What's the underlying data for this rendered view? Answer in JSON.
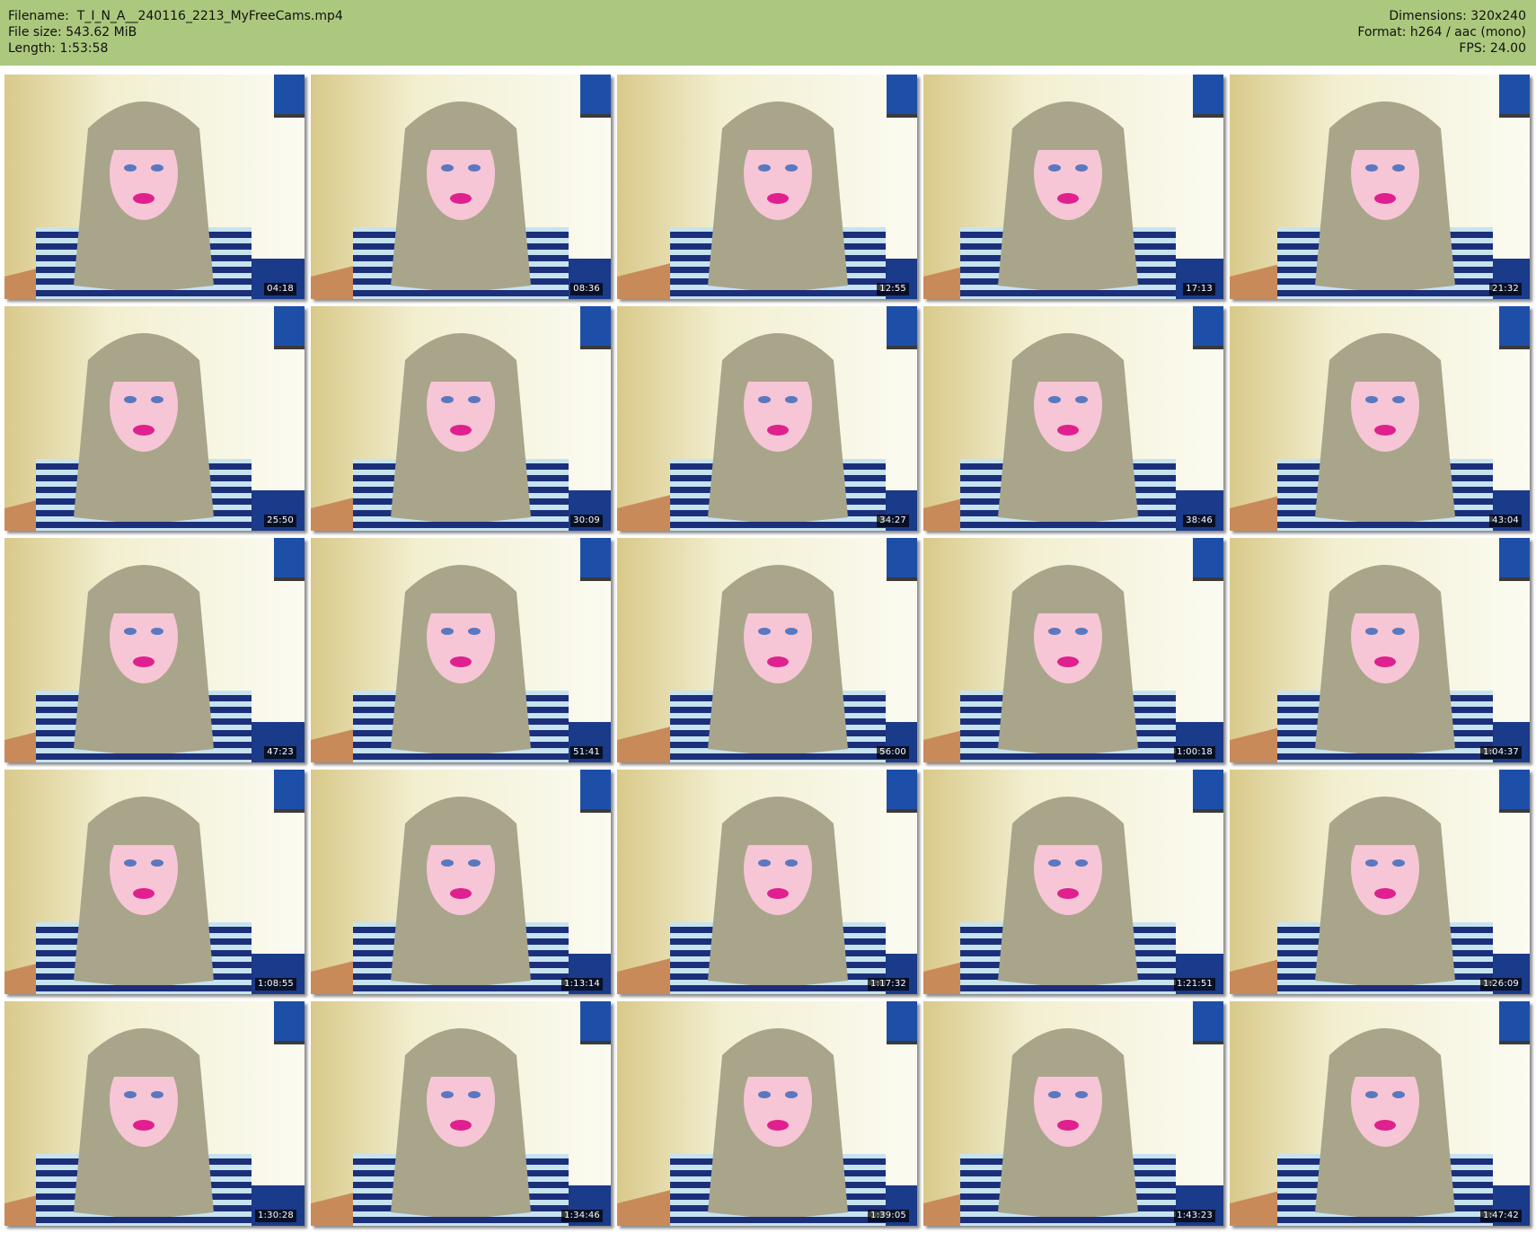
{
  "header": {
    "filename_label": "Filename:",
    "filename": "T_I_N_A__240116_2213_MyFreeCams.mp4",
    "filesize_label": "File size:",
    "filesize": "543.62 MiB",
    "length_label": "Length:",
    "length": "1:53:58",
    "dimensions_label": "Dimensions:",
    "dimensions": "320x240",
    "format_label": "Format:",
    "format": "h264 / aac (mono)",
    "fps_label": "FPS:",
    "fps": "24.00"
  },
  "thumbnails": [
    {
      "timestamp": "04:18"
    },
    {
      "timestamp": "08:36"
    },
    {
      "timestamp": "12:55"
    },
    {
      "timestamp": "17:13"
    },
    {
      "timestamp": "21:32"
    },
    {
      "timestamp": "25:50"
    },
    {
      "timestamp": "30:09"
    },
    {
      "timestamp": "34:27"
    },
    {
      "timestamp": "38:46"
    },
    {
      "timestamp": "43:04"
    },
    {
      "timestamp": "47:23"
    },
    {
      "timestamp": "51:41"
    },
    {
      "timestamp": "56:00"
    },
    {
      "timestamp": "1:00:18"
    },
    {
      "timestamp": "1:04:37"
    },
    {
      "timestamp": "1:08:55"
    },
    {
      "timestamp": "1:13:14"
    },
    {
      "timestamp": "1:17:32"
    },
    {
      "timestamp": "1:21:51"
    },
    {
      "timestamp": "1:26:09"
    },
    {
      "timestamp": "1:30:28"
    },
    {
      "timestamp": "1:34:46"
    },
    {
      "timestamp": "1:39:05"
    },
    {
      "timestamp": "1:43:23"
    },
    {
      "timestamp": "1:47:42"
    }
  ],
  "colors": {
    "header_bg": "#acc87e",
    "wall": "#f2efd0",
    "hair": "#a9a58a",
    "sweater_dark": "#1c2f7a",
    "sweater_light": "#c7e3f0",
    "lips": "#e0208f",
    "frame_blue": "#1d4fa8"
  }
}
